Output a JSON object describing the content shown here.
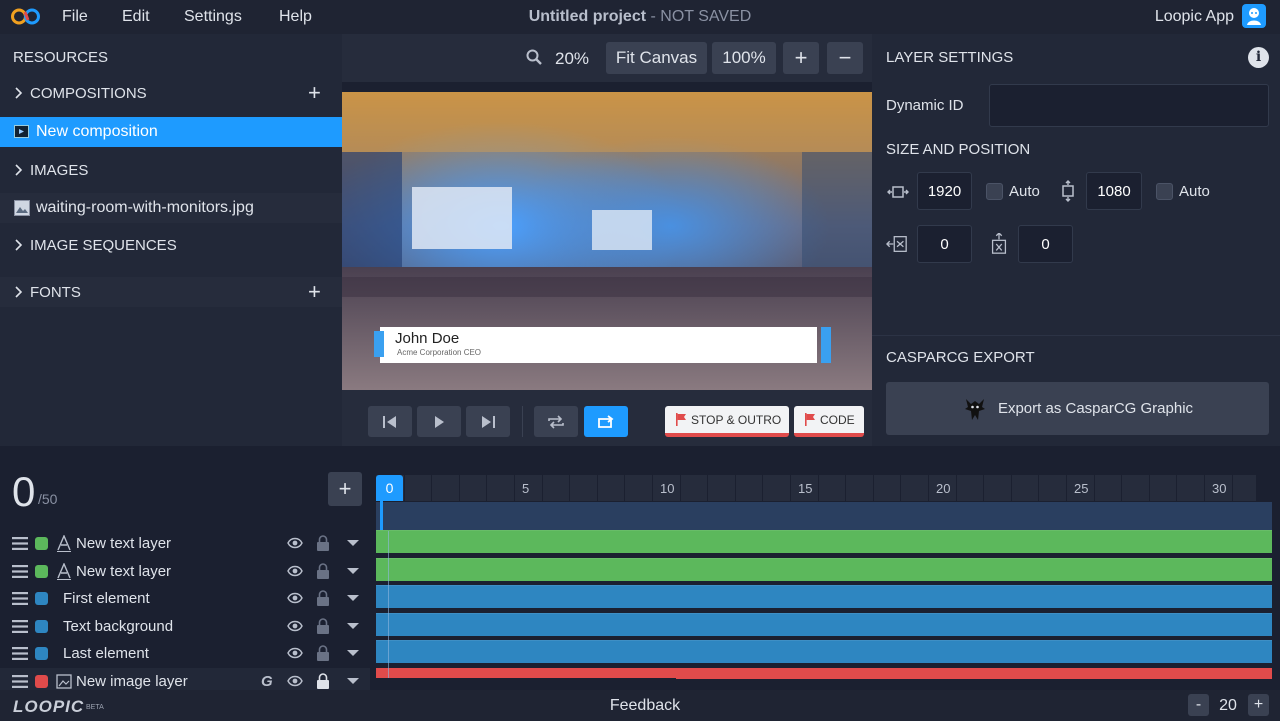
{
  "menu": {
    "file": "File",
    "edit": "Edit",
    "settings": "Settings",
    "help": "Help"
  },
  "project": {
    "title": "Untitled project",
    "status": "- NOT SAVED"
  },
  "account": {
    "label": "Loopic App"
  },
  "resources": {
    "title": "RESOURCES",
    "compositions": "COMPOSITIONS",
    "selected_composition": "New composition",
    "images": "IMAGES",
    "image_file": "waiting-room-with-monitors.jpg",
    "image_sequences": "IMAGE SEQUENCES",
    "fonts": "FONTS"
  },
  "zoom": {
    "value": "20%",
    "fit": "Fit Canvas",
    "full": "100%",
    "plus": "+",
    "minus": "−"
  },
  "preview": {
    "name": "John Doe",
    "subtitle": "Acme Corporation CEO"
  },
  "transport": {
    "stop_outro": "STOP & OUTRO",
    "code": "CODE"
  },
  "layer_settings": {
    "title": "LAYER SETTINGS",
    "info": "i",
    "dynamic_id_label": "Dynamic ID",
    "dynamic_id_value": "",
    "size_title": "SIZE AND POSITION",
    "width": "1920",
    "height": "1080",
    "auto1": "Auto",
    "auto2": "Auto",
    "x": "0",
    "y": "0",
    "casparcg_title": "CASPARCG EXPORT",
    "export_label": "Export as CasparCG Graphic"
  },
  "timeline": {
    "current_frame": "0",
    "total": "/50",
    "add": "+",
    "playhead": "0",
    "ticks": [
      "5",
      "10",
      "15",
      "20",
      "25",
      "30"
    ],
    "layers": [
      {
        "name": "New text layer",
        "color": "#5cb85c",
        "type": "text"
      },
      {
        "name": "New text layer",
        "color": "#5cb85c",
        "type": "text"
      },
      {
        "name": "First element",
        "color": "#2e86c1",
        "type": "shape"
      },
      {
        "name": "Text background",
        "color": "#2e86c1",
        "type": "shape"
      },
      {
        "name": "Last element",
        "color": "#2e86c1",
        "type": "shape"
      },
      {
        "name": "New image layer",
        "color": "#e04b4b",
        "type": "image",
        "g": "G"
      }
    ]
  },
  "status": {
    "brand": "LOOPIC",
    "brand_sup": "BETA",
    "feedback": "Feedback",
    "zoom_minus": "-",
    "zoom_value": "20",
    "zoom_plus": "+"
  },
  "colors": {
    "accent": "#1e9bff",
    "panel": "#222838",
    "green": "#5cb85c",
    "blue": "#2e86c1",
    "red": "#e04b4b"
  }
}
